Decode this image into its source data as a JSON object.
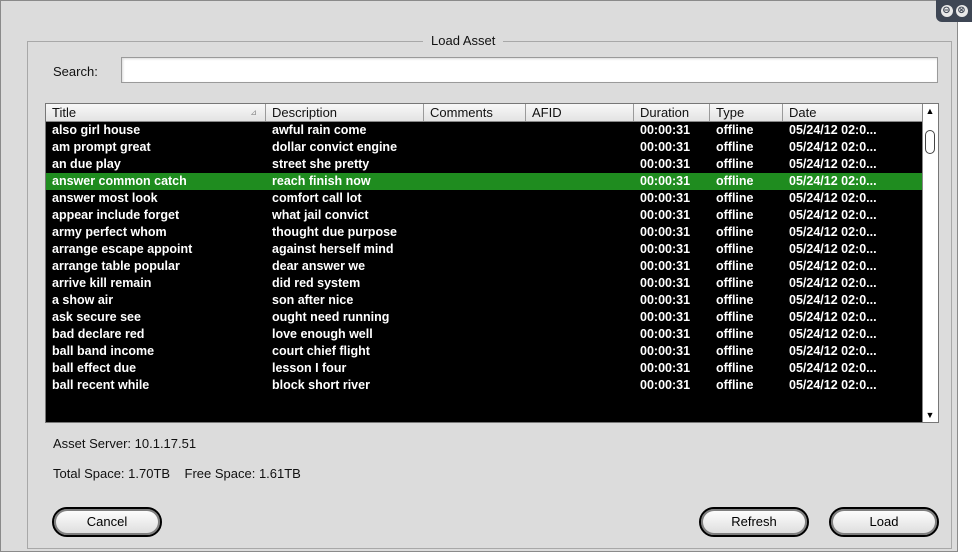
{
  "window": {
    "title": "Load Asset",
    "controls": {
      "minimize_glyph": "⊖",
      "close_glyph": "⊗"
    }
  },
  "search": {
    "label": "Search:",
    "value": "",
    "placeholder": ""
  },
  "table": {
    "columns": [
      "Title",
      "Description",
      "Comments",
      "AFID",
      "Duration",
      "Type",
      "Date"
    ],
    "sort_column": "Title",
    "selected_row": 3,
    "rows": [
      {
        "title": "also girl house",
        "description": "awful rain come",
        "comments": "",
        "afid": "",
        "duration": "00:00:31",
        "type": "offline",
        "date": "05/24/12  02:0..."
      },
      {
        "title": "am prompt great",
        "description": "dollar convict engine",
        "comments": "",
        "afid": "",
        "duration": "00:00:31",
        "type": "offline",
        "date": "05/24/12  02:0..."
      },
      {
        "title": "an due play",
        "description": "street she pretty",
        "comments": "",
        "afid": "",
        "duration": "00:00:31",
        "type": "offline",
        "date": "05/24/12  02:0..."
      },
      {
        "title": "answer common catch",
        "description": "reach finish now",
        "comments": "",
        "afid": "",
        "duration": "00:00:31",
        "type": "offline",
        "date": "05/24/12  02:0..."
      },
      {
        "title": "answer most look",
        "description": "comfort call lot",
        "comments": "",
        "afid": "",
        "duration": "00:00:31",
        "type": "offline",
        "date": "05/24/12  02:0..."
      },
      {
        "title": "appear include forget",
        "description": "what jail convict",
        "comments": "",
        "afid": "",
        "duration": "00:00:31",
        "type": "offline",
        "date": "05/24/12  02:0..."
      },
      {
        "title": "army perfect whom",
        "description": "thought due purpose",
        "comments": "",
        "afid": "",
        "duration": "00:00:31",
        "type": "offline",
        "date": "05/24/12  02:0..."
      },
      {
        "title": "arrange escape appoint",
        "description": "against herself mind",
        "comments": "",
        "afid": "",
        "duration": "00:00:31",
        "type": "offline",
        "date": "05/24/12  02:0..."
      },
      {
        "title": "arrange table popular",
        "description": "dear answer we",
        "comments": "",
        "afid": "",
        "duration": "00:00:31",
        "type": "offline",
        "date": "05/24/12  02:0..."
      },
      {
        "title": "arrive kill remain",
        "description": "did red system",
        "comments": "",
        "afid": "",
        "duration": "00:00:31",
        "type": "offline",
        "date": "05/24/12  02:0..."
      },
      {
        "title": "a show air",
        "description": "son after nice",
        "comments": "",
        "afid": "",
        "duration": "00:00:31",
        "type": "offline",
        "date": "05/24/12  02:0..."
      },
      {
        "title": "ask secure see",
        "description": "ought need running",
        "comments": "",
        "afid": "",
        "duration": "00:00:31",
        "type": "offline",
        "date": "05/24/12  02:0..."
      },
      {
        "title": "bad declare red",
        "description": "love enough well",
        "comments": "",
        "afid": "",
        "duration": "00:00:31",
        "type": "offline",
        "date": "05/24/12  02:0..."
      },
      {
        "title": "ball band income",
        "description": "court chief flight",
        "comments": "",
        "afid": "",
        "duration": "00:00:31",
        "type": "offline",
        "date": "05/24/12  02:0..."
      },
      {
        "title": "ball effect due",
        "description": "lesson I four",
        "comments": "",
        "afid": "",
        "duration": "00:00:31",
        "type": "offline",
        "date": "05/24/12  02:0..."
      },
      {
        "title": "ball recent while",
        "description": "block short river",
        "comments": "",
        "afid": "",
        "duration": "00:00:31",
        "type": "offline",
        "date": "05/24/12  02:0..."
      }
    ]
  },
  "info": {
    "asset_server": "Asset Server: 10.1.17.51",
    "space": "Total Space: 1.70TB    Free Space: 1.61TB"
  },
  "buttons": {
    "cancel": "Cancel",
    "refresh": "Refresh",
    "load": "Load"
  },
  "colors": {
    "selection": "#1f8c1f",
    "table_bg": "#000000",
    "window_bg": "#dcdcdc"
  }
}
